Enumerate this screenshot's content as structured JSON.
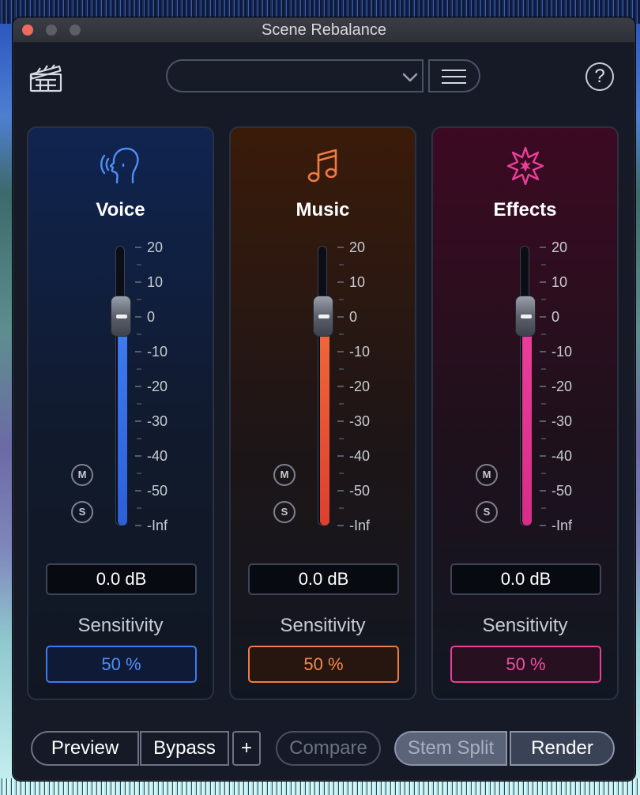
{
  "window": {
    "title": "Scene Rebalance"
  },
  "header": {
    "preset_value": "",
    "menu_icon": "hamburger-icon",
    "help_label": "?",
    "clapper_icon": "clapperboard-icon"
  },
  "scale": {
    "labels": [
      "20",
      "10",
      "0",
      "-10",
      "-20",
      "-30",
      "-40",
      "-50",
      "-Inf"
    ]
  },
  "panels": [
    {
      "key": "voice",
      "title": "Voice",
      "icon": "speaking-head-icon",
      "accent": "#3a7cf2",
      "level_db": 0.0,
      "gain_display": "0.0 dB",
      "mute_label": "M",
      "solo_label": "S",
      "sensitivity_label": "Sensitivity",
      "sensitivity_value": "50 %"
    },
    {
      "key": "music",
      "title": "Music",
      "icon": "music-note-icon",
      "accent": "#f07a42",
      "level_db": 0.0,
      "gain_display": "0.0 dB",
      "mute_label": "M",
      "solo_label": "S",
      "sensitivity_label": "Sensitivity",
      "sensitivity_value": "50 %"
    },
    {
      "key": "effects",
      "title": "Effects",
      "icon": "burst-star-icon",
      "accent": "#ea3f98",
      "level_db": 0.0,
      "gain_display": "0.0 dB",
      "mute_label": "M",
      "solo_label": "S",
      "sensitivity_label": "Sensitivity",
      "sensitivity_value": "50 %"
    }
  ],
  "footer": {
    "preview_label": "Preview",
    "bypass_label": "Bypass",
    "plus_label": "+",
    "compare_label": "Compare",
    "stem_split_label": "Stem Split",
    "render_label": "Render"
  }
}
